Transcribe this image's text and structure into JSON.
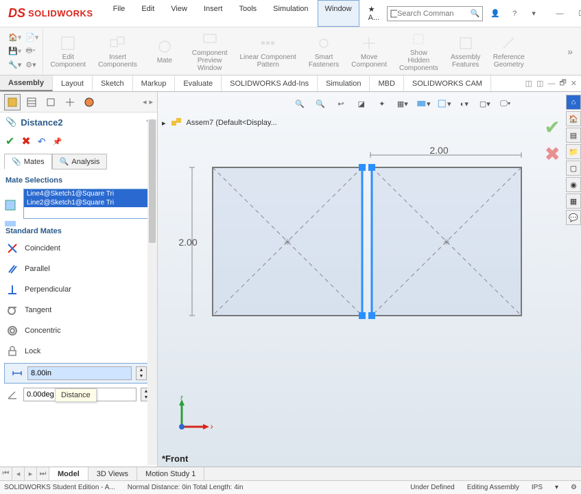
{
  "app": {
    "brand": "SOLIDWORKS",
    "search_placeholder": "Search Comman"
  },
  "menu": {
    "file": "File",
    "edit": "Edit",
    "view": "View",
    "insert": "Insert",
    "tools": "Tools",
    "simulation": "Simulation",
    "window": "Window",
    "extra": "A..."
  },
  "ribbon": {
    "edit_component": "Edit\nComponent",
    "insert_components": "Insert\nComponents",
    "mate": "Mate",
    "component_preview": "Component\nPreview\nWindow",
    "linear_pattern": "Linear Component\nPattern",
    "smart_fasteners": "Smart\nFasteners",
    "move_component": "Move\nComponent",
    "show_hidden": "Show\nHidden\nComponents",
    "assembly_features": "Assembly\nFeatures",
    "reference_geometry": "Reference\nGeometry"
  },
  "tabs": {
    "assembly": "Assembly",
    "layout": "Layout",
    "sketch": "Sketch",
    "markup": "Markup",
    "evaluate": "Evaluate",
    "addins": "SOLIDWORKS Add-Ins",
    "simulation": "Simulation",
    "mbd": "MBD",
    "cam": "SOLIDWORKS CAM"
  },
  "panel": {
    "title": "Distance2",
    "mates_tab": "Mates",
    "analysis_tab": "Analysis",
    "mate_selections_header": "Mate Selections",
    "selections": [
      "Line4@Sketch1@Square Tri",
      "Line2@Sketch1@Square Tri"
    ],
    "standard_mates_header": "Standard Mates",
    "coincident": "Coincident",
    "parallel": "Parallel",
    "perpendicular": "Perpendicular",
    "tangent": "Tangent",
    "concentric": "Concentric",
    "lock": "Lock",
    "distance_value": "8.00in",
    "angle_value": "0.00deg",
    "tooltip": "Distance"
  },
  "canvas": {
    "breadcrumb": "Assem7  (Default<Display...",
    "dim_h": "2.00",
    "dim_v": "2.00",
    "view_label": "*Front",
    "triad_x": "x",
    "triad_y": "y"
  },
  "bottom_tabs": {
    "model": "Model",
    "threed": "3D Views",
    "motion": "Motion Study 1"
  },
  "status": {
    "left": "SOLIDWORKS Student Edition - A...",
    "mid": "Normal Distance: 0in Total Length: 4in",
    "underdef": "Under Defined",
    "editing": "Editing Assembly",
    "units": "IPS"
  }
}
